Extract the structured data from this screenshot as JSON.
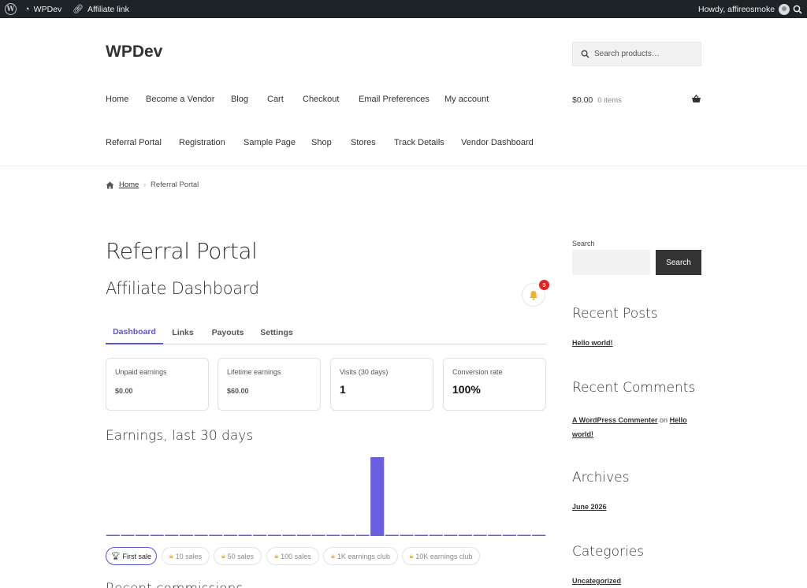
{
  "adminbar": {
    "site_name": "WPDev",
    "affiliate_link": "Affiliate link",
    "greeting": "Howdy, affireosmoke"
  },
  "header": {
    "site_title": "WPDev",
    "search_placeholder": "Search products…",
    "nav_row1": [
      "Home",
      "Become a Vendor",
      "Blog",
      "Cart",
      "Checkout",
      "Email Preferences",
      "My account"
    ],
    "nav_row2": [
      "Referral Portal",
      "Registration",
      "Sample Page",
      "Shop",
      "Stores",
      "Track Details",
      "Vendor Dashboard"
    ],
    "cart_amount": "$0.00",
    "cart_count": "0 items"
  },
  "breadcrumb": {
    "home": "Home",
    "current": "Referral Portal"
  },
  "main": {
    "page_title": "Referral Portal",
    "dashboard_title": "Affiliate Dashboard",
    "notification_count": "3",
    "tabs": [
      "Dashboard",
      "Links",
      "Payouts",
      "Settings"
    ],
    "active_tab": "Dashboard",
    "cards": [
      {
        "label": "Unpaid earnings",
        "value": "$0.00"
      },
      {
        "label": "Lifetime earnings",
        "value": "$60.00"
      },
      {
        "label": "Visits (30 days)",
        "value": "1"
      },
      {
        "label": "Conversion rate",
        "value": "100%"
      }
    ],
    "earnings_title": "Earnings, last 30 days",
    "badges": [
      {
        "label": "First sale",
        "icon": "trophy-icon",
        "earned": true
      },
      {
        "label": "10 sales",
        "icon": "lock-icon",
        "earned": false
      },
      {
        "label": "50 sales",
        "icon": "lock-icon",
        "earned": false
      },
      {
        "label": "100 sales",
        "icon": "lock-icon",
        "earned": false
      },
      {
        "label": "1K earnings club",
        "icon": "lock-icon",
        "earned": false
      },
      {
        "label": "10K earnings club",
        "icon": "lock-icon",
        "earned": false
      }
    ],
    "next_heading": "Recent commissions"
  },
  "chart_data": {
    "type": "bar",
    "title": "Earnings, last 30 days",
    "days": 30,
    "values": [
      0,
      0,
      0,
      0,
      0,
      0,
      0,
      0,
      0,
      0,
      0,
      0,
      0,
      0,
      0,
      0,
      0,
      0,
      60,
      0,
      0,
      0,
      0,
      0,
      0,
      0,
      0,
      0,
      0,
      0
    ],
    "ylim": [
      0,
      60
    ],
    "color": "#6a5fe0"
  },
  "sidebar": {
    "search_label": "Search",
    "search_button": "Search",
    "recent_posts_title": "Recent Posts",
    "recent_posts": [
      "Hello world!"
    ],
    "recent_comments_title": "Recent Comments",
    "comment_author": "A WordPress Commenter",
    "comment_on": "on",
    "comment_post": "Hello world!",
    "archives_title": "Archives",
    "archives": [
      "June 2026"
    ],
    "categories_title": "Categories",
    "categories": [
      "Uncategorized"
    ]
  },
  "colors": {
    "accent": "#5b55d6",
    "adminbar": "#1d2327",
    "badge_red": "#e02424"
  }
}
